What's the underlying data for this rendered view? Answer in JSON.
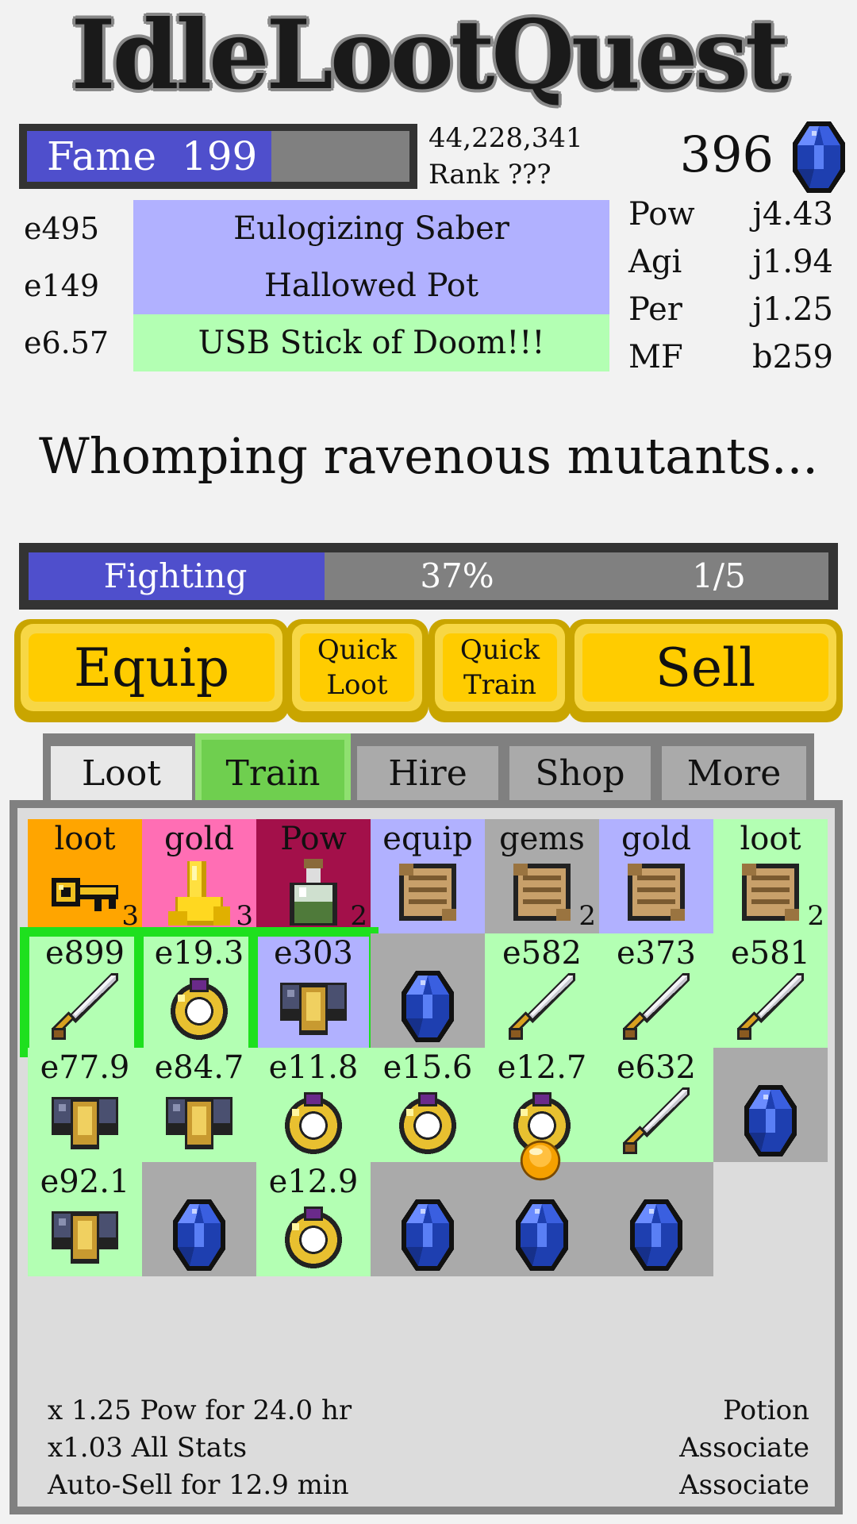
{
  "app": {
    "title": "IdleLootQuest"
  },
  "fame": {
    "label": "Fame  199",
    "fill_fraction": 0.64,
    "points": "44,228,341",
    "rank": "Rank ???"
  },
  "gems": {
    "count": "396"
  },
  "colors": {
    "rarity_blue": "#b1b1ff",
    "rarity_green": "#b3ffb3",
    "bar_fill": "#4f4fcc",
    "button_yellow": "#ffcc00",
    "tab_active": "#6fcf4f",
    "select_green": "#1ee01e",
    "orange": "#ffa500",
    "pink": "#ff6eb4",
    "maroon": "#a3104a",
    "grey": "#aaaaaa"
  },
  "equipped": [
    {
      "value": "e495",
      "name": "Eulogizing Saber",
      "rarity": "blue"
    },
    {
      "value": "e149",
      "name": "Hallowed Pot",
      "rarity": "blue"
    },
    {
      "value": "e6.57",
      "name": "USB Stick of Doom!!!",
      "rarity": "green"
    }
  ],
  "stats": [
    {
      "name": "Pow",
      "value": "j4.43"
    },
    {
      "name": "Agi",
      "value": "j1.94"
    },
    {
      "name": "Per",
      "value": "j1.25"
    },
    {
      "name": "MF",
      "value": "b259"
    }
  ],
  "activity": "Whomping ravenous mutants...",
  "progress": {
    "state": "Fighting",
    "percent_label": "37%",
    "fraction": 0.37,
    "wave": "1/5"
  },
  "buttons": {
    "equip": "Equip",
    "quick_loot_1": "Quick",
    "quick_loot_2": "Loot",
    "quick_train_1": "Quick",
    "quick_train_2": "Train",
    "sell": "Sell"
  },
  "tabs": [
    {
      "label": "Loot",
      "active": false
    },
    {
      "label": "Train",
      "active": true
    },
    {
      "label": "Hire",
      "active": false
    },
    {
      "label": "Shop",
      "active": false
    },
    {
      "label": "More",
      "active": false
    }
  ],
  "grid": [
    {
      "label": "loot",
      "bg": "orange",
      "icon": "key-icon",
      "count": "3"
    },
    {
      "label": "gold",
      "bg": "pink",
      "icon": "gold-coins-icon",
      "count": "3"
    },
    {
      "label": "Pow",
      "bg": "maroon",
      "icon": "potion-icon",
      "count": "2"
    },
    {
      "label": "equip",
      "bg": "blue",
      "icon": "scroll-icon",
      "count": ""
    },
    {
      "label": "gems",
      "bg": "grey",
      "icon": "scroll-icon",
      "count": "2"
    },
    {
      "label": "gold",
      "bg": "blue",
      "icon": "scroll-icon",
      "count": ""
    },
    {
      "label": "loot",
      "bg": "green",
      "icon": "scroll-icon",
      "count": "2"
    },
    {
      "label": "e899",
      "bg": "green",
      "icon": "sword-icon",
      "selected": true
    },
    {
      "label": "e19.3",
      "bg": "green",
      "icon": "ring-icon",
      "selected": true
    },
    {
      "label": "e303",
      "bg": "blue",
      "icon": "armor-icon",
      "selected": true
    },
    {
      "label": "",
      "bg": "grey",
      "icon": "gem-icon"
    },
    {
      "label": "e582",
      "bg": "green",
      "icon": "sword-icon"
    },
    {
      "label": "e373",
      "bg": "green",
      "icon": "sword-icon"
    },
    {
      "label": "e581",
      "bg": "green",
      "icon": "sword-icon"
    },
    {
      "label": "e77.9",
      "bg": "green",
      "icon": "armor-icon"
    },
    {
      "label": "e84.7",
      "bg": "green",
      "icon": "armor-icon"
    },
    {
      "label": "e11.8",
      "bg": "green",
      "icon": "ring-icon"
    },
    {
      "label": "e15.6",
      "bg": "green",
      "icon": "ring-icon"
    },
    {
      "label": "e12.7",
      "bg": "green",
      "icon": "ring-icon"
    },
    {
      "label": "e632",
      "bg": "green",
      "icon": "sword-icon"
    },
    {
      "label": "",
      "bg": "grey",
      "icon": "gem-icon"
    },
    {
      "label": "e92.1",
      "bg": "green",
      "icon": "armor-icon"
    },
    {
      "label": "",
      "bg": "grey",
      "icon": "gem-icon"
    },
    {
      "label": "e12.9",
      "bg": "green",
      "icon": "ring-icon"
    },
    {
      "label": "",
      "bg": "grey",
      "icon": "gem-icon"
    },
    {
      "label": "",
      "bg": "grey",
      "icon": "gem-icon",
      "orb": true
    },
    {
      "label": "",
      "bg": "grey",
      "icon": "gem-icon"
    }
  ],
  "buffs": [
    {
      "text": "x 1.25 Pow for 24.0 hr",
      "source": "Potion"
    },
    {
      "text": "x1.03 All Stats",
      "source": "Associate"
    },
    {
      "text": "Auto-Sell for 12.9 min",
      "source": "Associate"
    }
  ]
}
